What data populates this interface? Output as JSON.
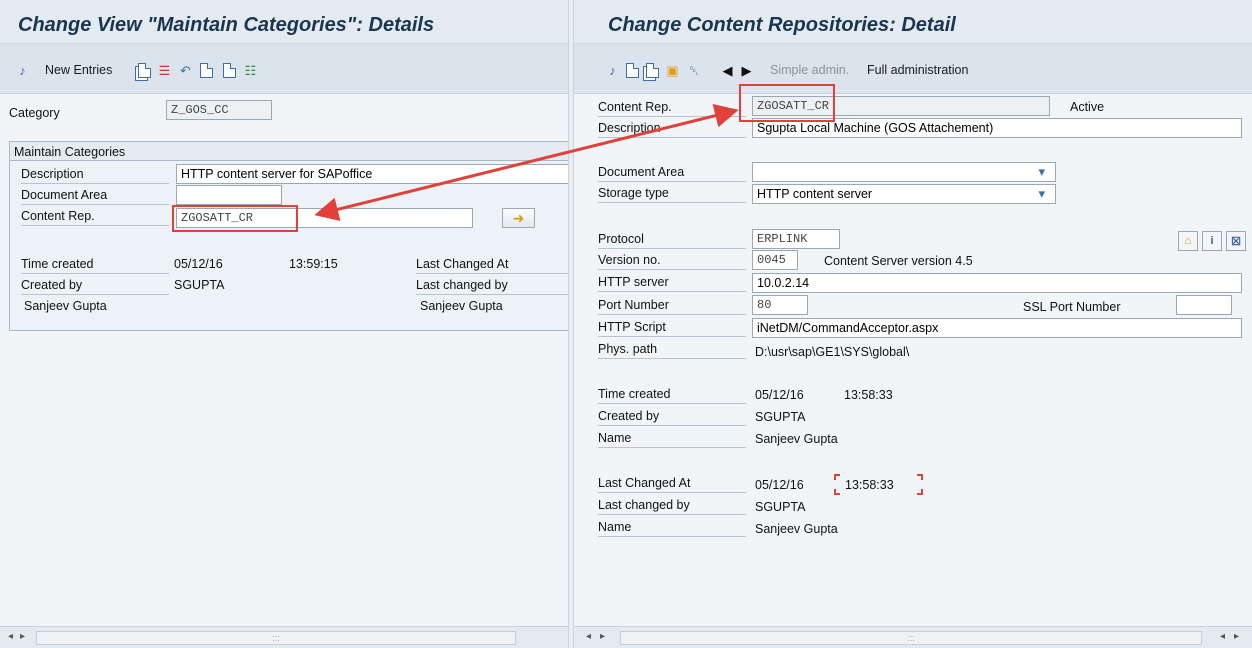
{
  "left": {
    "title": "Change View \"Maintain Categories\": Details",
    "toolbar": {
      "new_entries_label": "New Entries"
    },
    "category_label": "Category",
    "category_value": "Z_GOS_CC",
    "group_title": "Maintain Categories",
    "description_label": "Description",
    "description_value": "HTTP content server for SAPoffice",
    "document_area_label": "Document Area",
    "document_area_value": "",
    "content_rep_label": "Content Rep.",
    "content_rep_value": "ZGOSATT_CR",
    "time_created_label": "Time created",
    "time_created_date": "05/12/16",
    "time_created_time": "13:59:15",
    "last_changed_at_label": "Last Changed At",
    "created_by_label": "Created by",
    "created_by_value": "SGUPTA",
    "last_changed_by_label": "Last changed by",
    "created_by_name": "Sanjeev Gupta",
    "last_changed_by_name": "Sanjeev Gupta"
  },
  "right": {
    "title": "Change Content Repositories: Detail",
    "toolbar": {
      "simple_admin_label": "Simple admin.",
      "full_admin_label": "Full administration"
    },
    "content_rep_label": "Content Rep.",
    "content_rep_value": "ZGOSATT_CR",
    "status_value": "Active",
    "description_label": "Description",
    "description_value": "Sgupta Local Machine (GOS Attachement)",
    "document_area_label": "Document Area",
    "document_area_value": "",
    "storage_type_label": "Storage type",
    "storage_type_value": "HTTP content server",
    "protocol_label": "Protocol",
    "protocol_value": "ERPLINK",
    "version_label": "Version no.",
    "version_value": "0045",
    "version_text": "Content Server version 4.5",
    "http_server_label": "HTTP server",
    "http_server_value": "10.0.2.14",
    "port_label": "Port Number",
    "port_value": "80",
    "ssl_port_label": "SSL Port Number",
    "ssl_port_value": "",
    "http_script_label": "HTTP Script",
    "http_script_value": "iNetDM/CommandAcceptor.aspx",
    "phys_path_label": "Phys. path",
    "phys_path_value": "D:\\usr\\sap\\GE1\\SYS\\global\\",
    "time_created_label": "Time created",
    "time_created_date": "05/12/16",
    "time_created_time": "13:58:33",
    "created_by_label": "Created by",
    "created_by_value": "SGUPTA",
    "name_label": "Name",
    "name_value": "Sanjeev Gupta",
    "last_changed_at_label": "Last Changed At",
    "last_changed_date": "05/12/16",
    "last_changed_time": "13:58:33",
    "last_changed_by_label": "Last changed by",
    "last_changed_by_value": "SGUPTA",
    "name2_label": "Name",
    "name2_value": "Sanjeev Gupta",
    "icon_btn_info": "i"
  },
  "statusbar": {
    "scroll_grip": ":::"
  },
  "colors": {
    "annotation_red": "#e0413a",
    "title_blue": "#1a3550",
    "toolbar_bg": "#dbe4ec"
  },
  "icons": [
    "glasses-icon",
    "copy-icon",
    "delete-icon",
    "undo-icon",
    "select-icon",
    "transport-icon",
    "trash-icon",
    "prev-icon",
    "next-icon"
  ]
}
